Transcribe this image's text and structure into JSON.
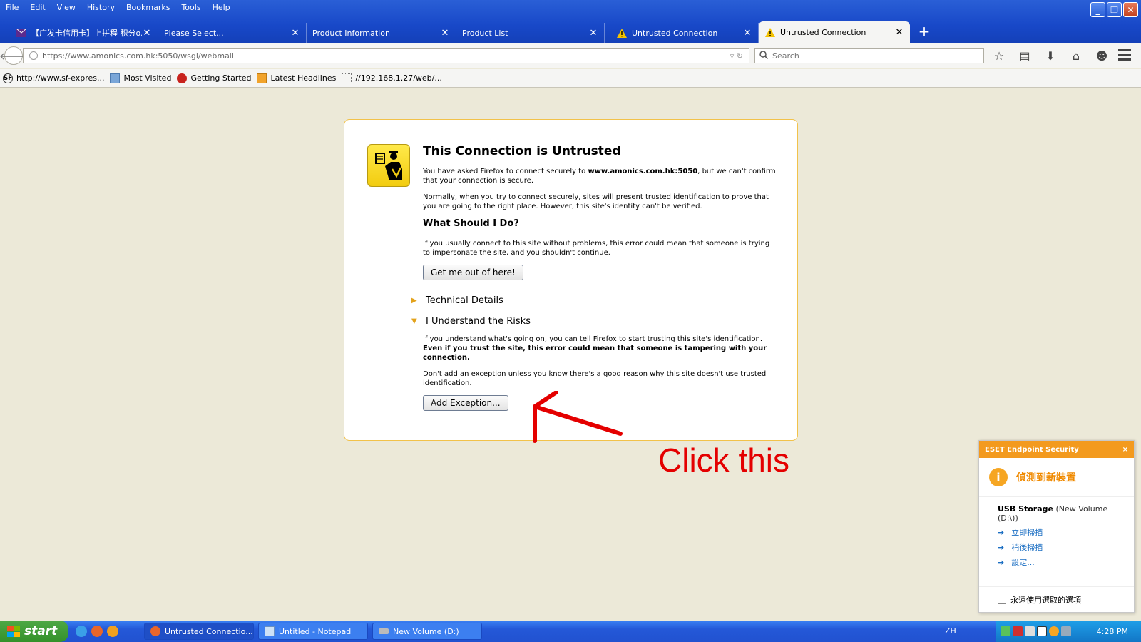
{
  "menubar": [
    "File",
    "Edit",
    "View",
    "History",
    "Bookmarks",
    "Tools",
    "Help"
  ],
  "tabs": [
    {
      "label": "【广发卡信用卡】上拼程 积分o...",
      "icon": "mail-icon"
    },
    {
      "label": "Please Select...",
      "icon": ""
    },
    {
      "label": "Product Information",
      "icon": ""
    },
    {
      "label": "Product List",
      "icon": ""
    },
    {
      "label": "Untrusted Connection",
      "icon": "warning-icon"
    },
    {
      "label": "Untrusted Connection",
      "icon": "warning-icon"
    }
  ],
  "navbar": {
    "url": "https://www.amonics.com.hk:5050/wsgi/webmail",
    "search_placeholder": "Search"
  },
  "bookmarks": [
    {
      "label": "http://www.sf-expres...",
      "icon": "sf-icon"
    },
    {
      "label": "Most Visited",
      "icon": "folder-icon"
    },
    {
      "label": "Getting Started",
      "icon": "firefox-icon"
    },
    {
      "label": "Latest Headlines",
      "icon": "rss-icon"
    },
    {
      "label": "//192.168.1.27/web/...",
      "icon": "page-icon"
    }
  ],
  "page": {
    "title": "This Connection is Untrusted",
    "p1_pre": "You have asked Firefox to connect securely to ",
    "p1_host": "www.amonics.com.hk:5050",
    "p1_post": ", but we can't confirm that your connection is secure.",
    "p2": "Normally, when you try to connect securely, sites will present trusted identification to prove that you are going to the right place. However, this site's identity can't be verified.",
    "what_heading": "What Should I Do?",
    "p3": "If you usually connect to this site without problems, this error could mean that someone is trying to impersonate the site, and you shouldn't continue.",
    "get_out_button": "Get me out of here!",
    "technical_details": "Technical Details",
    "understand_risks": "I Understand the Risks",
    "p4_pre": "If you understand what's going on, you can tell Firefox to start trusting this site's identification. ",
    "p4_bold": "Even if you trust the site, this error could mean that someone is tampering with your connection.",
    "p5": "Don't add an exception unless you know there's a good reason why this site doesn't use trusted identification.",
    "add_exception_button": "Add Exception..."
  },
  "annotation": {
    "text": "Click this",
    "color": "#e40000"
  },
  "eset": {
    "header": "ESET Endpoint Security",
    "close": "×",
    "alert_title": "偵測到新裝置",
    "device_name": "USB Storage",
    "device_detail": " (New Volume (D:\\))",
    "links": [
      "立即掃描",
      "稍後掃描",
      "設定..."
    ],
    "remember_label": "永遠使用選取的選項"
  },
  "taskbar": {
    "start": "start",
    "tasks": [
      {
        "label": "Untrusted Connectio...",
        "icon": "firefox-icon"
      },
      {
        "label": "Untitled - Notepad",
        "icon": "notepad-icon"
      },
      {
        "label": "New Volume (D:)",
        "icon": "drive-icon"
      }
    ],
    "lang": "ZH",
    "clock": "4:28 PM"
  }
}
